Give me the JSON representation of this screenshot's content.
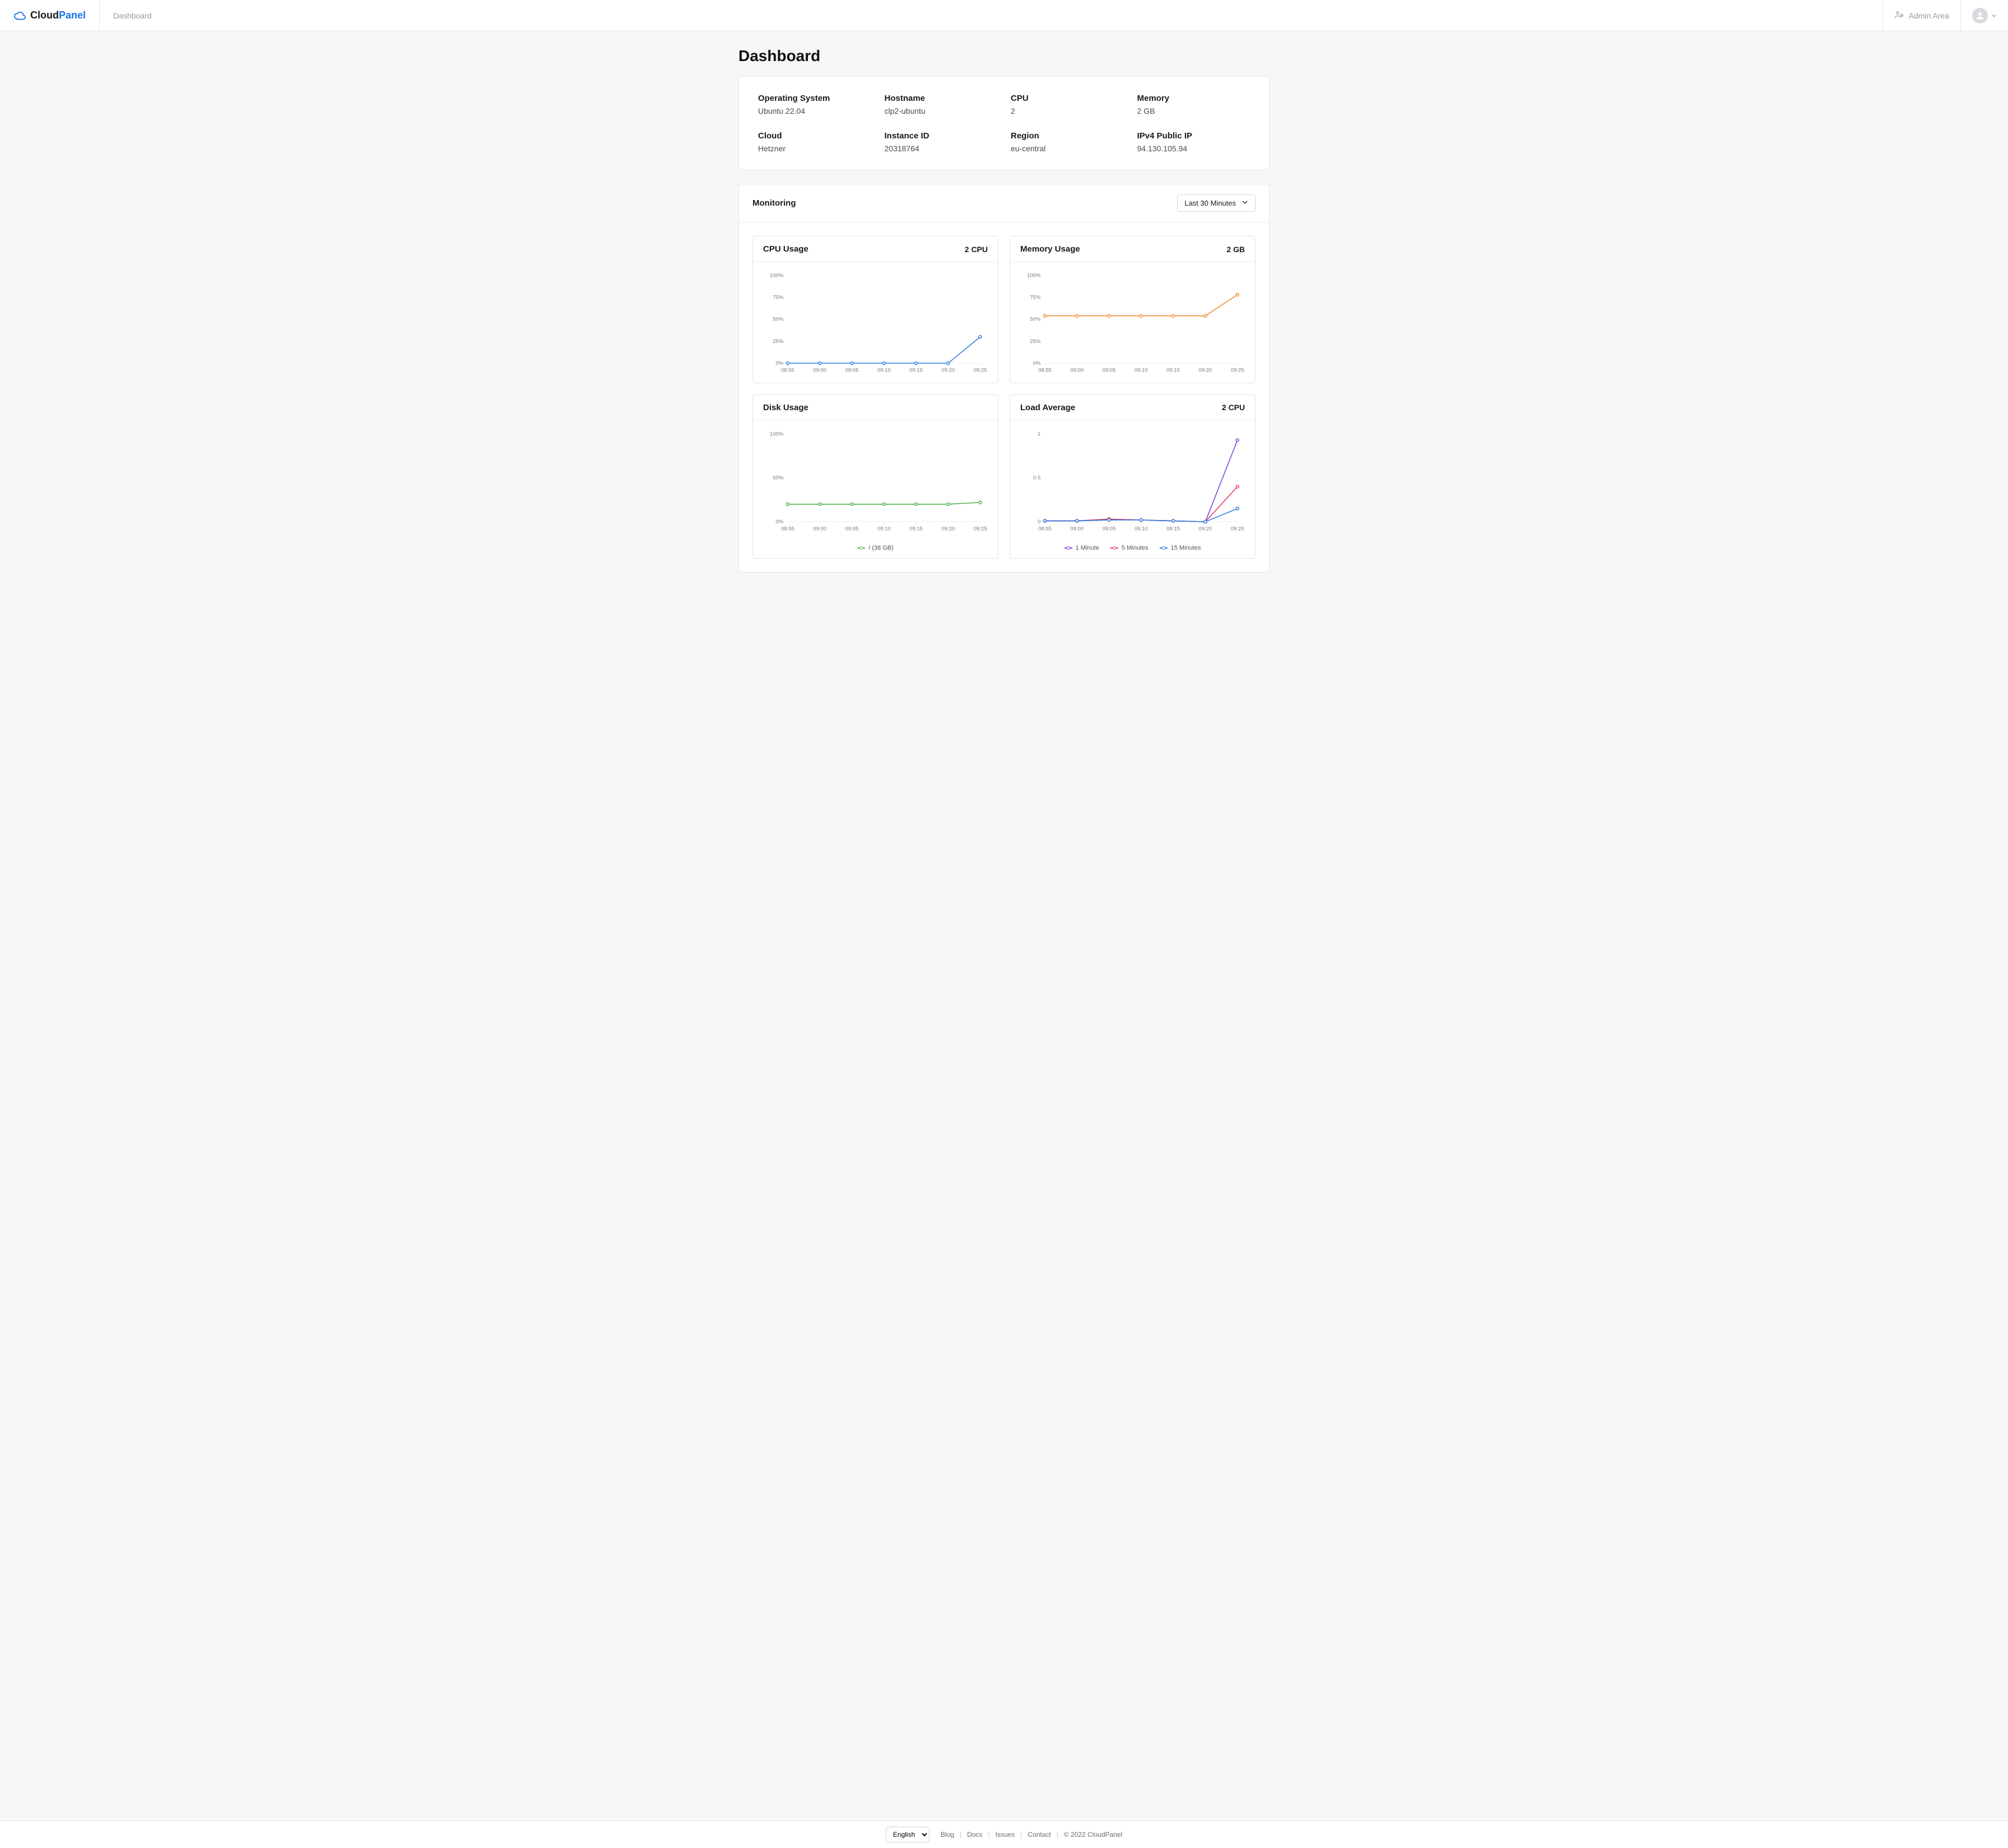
{
  "brand": {
    "name1": "Cloud",
    "name2": "Panel"
  },
  "nav": {
    "dashboard": "Dashboard",
    "admin_area": "Admin Area"
  },
  "page": {
    "title": "Dashboard"
  },
  "info": [
    {
      "label": "Operating System",
      "value": "Ubuntu 22.04"
    },
    {
      "label": "Hostname",
      "value": "clp2-ubuntu"
    },
    {
      "label": "CPU",
      "value": "2"
    },
    {
      "label": "Memory",
      "value": "2 GB"
    },
    {
      "label": "Cloud",
      "value": "Hetzner"
    },
    {
      "label": "Instance ID",
      "value": "20318764"
    },
    {
      "label": "Region",
      "value": "eu-central"
    },
    {
      "label": "IPv4 Public IP",
      "value": "94.130.105.94"
    }
  ],
  "monitoring": {
    "title": "Monitoring",
    "range_label": "Last 30 Minutes"
  },
  "charts": {
    "cpu": {
      "title": "CPU Usage",
      "meta": "2 CPU"
    },
    "memory": {
      "title": "Memory Usage",
      "meta": "2 GB"
    },
    "disk": {
      "title": "Disk Usage",
      "meta": ""
    },
    "load": {
      "title": "Load Average",
      "meta": "2 CPU"
    }
  },
  "footer": {
    "language": "English",
    "links": {
      "blog": "Blog",
      "docs": "Docs",
      "issues": "Issues",
      "contact": "Contact"
    },
    "copyright": "© 2022  CloudPanel"
  },
  "colors": {
    "cpu": "#2f7de1",
    "memory": "#f08c2e",
    "disk": "#4fb34f",
    "load_1": "#7a3fd6",
    "load_5": "#e23b5a",
    "load_15": "#2f7de1"
  },
  "chart_data": [
    {
      "id": "cpu",
      "type": "line",
      "title": "CPU Usage",
      "meta": "2 CPU",
      "ylabel": "%",
      "ylim": [
        0,
        100
      ],
      "yticks": [
        0,
        25,
        50,
        75,
        100
      ],
      "ytick_labels": [
        "0%",
        "25%",
        "50%",
        "75%",
        "100%"
      ],
      "categories": [
        "08:55",
        "09:00",
        "09:05",
        "09:10",
        "09:15",
        "09:20",
        "09:25"
      ],
      "series": [
        {
          "name": "CPU",
          "color": "#2f7de1",
          "values": [
            0,
            0,
            0,
            0,
            0,
            0,
            30
          ]
        }
      ]
    },
    {
      "id": "memory",
      "type": "line",
      "title": "Memory Usage",
      "meta": "2 GB",
      "ylabel": "%",
      "ylim": [
        0,
        100
      ],
      "yticks": [
        0,
        25,
        50,
        75,
        100
      ],
      "ytick_labels": [
        "0%",
        "25%",
        "50%",
        "75%",
        "100%"
      ],
      "categories": [
        "08:55",
        "09:00",
        "09:05",
        "09:10",
        "09:15",
        "09:20",
        "09:25"
      ],
      "series": [
        {
          "name": "Memory",
          "color": "#f08c2e",
          "values": [
            54,
            54,
            54,
            54,
            54,
            54,
            78
          ]
        }
      ]
    },
    {
      "id": "disk",
      "type": "line",
      "title": "Disk Usage",
      "meta": "",
      "ylabel": "%",
      "ylim": [
        0,
        100
      ],
      "yticks": [
        0,
        50,
        100
      ],
      "ytick_labels": [
        "0%",
        "50%",
        "100%"
      ],
      "categories": [
        "08:55",
        "09:00",
        "09:05",
        "09:10",
        "09:15",
        "09:20",
        "09:25"
      ],
      "series": [
        {
          "name": "/ (38 GB)",
          "color": "#4fb34f",
          "values": [
            20,
            20,
            20,
            20,
            20,
            20,
            22
          ]
        }
      ],
      "legend": [
        "/ (38 GB)"
      ]
    },
    {
      "id": "load",
      "type": "line",
      "title": "Load Average",
      "meta": "2 CPU",
      "ylabel": "",
      "ylim": [
        0,
        1
      ],
      "yticks": [
        0,
        0.5,
        1
      ],
      "ytick_labels": [
        "0",
        "0.5",
        "1"
      ],
      "categories": [
        "08:55",
        "09:00",
        "09:05",
        "09:10",
        "09:15",
        "09:20",
        "09:25"
      ],
      "series": [
        {
          "name": "1 Minute",
          "color": "#7a3fd6",
          "values": [
            0.01,
            0.01,
            0.03,
            0.02,
            0.01,
            0.0,
            0.93
          ]
        },
        {
          "name": "5 Minutes",
          "color": "#e23b5a",
          "values": [
            0.01,
            0.01,
            0.03,
            0.02,
            0.01,
            0.0,
            0.4
          ]
        },
        {
          "name": "15 Minutes",
          "color": "#2f7de1",
          "values": [
            0.01,
            0.01,
            0.02,
            0.02,
            0.01,
            0.0,
            0.15
          ]
        }
      ],
      "legend": [
        "1 Minute",
        "5 Minutes",
        "15 Minutes"
      ]
    }
  ]
}
